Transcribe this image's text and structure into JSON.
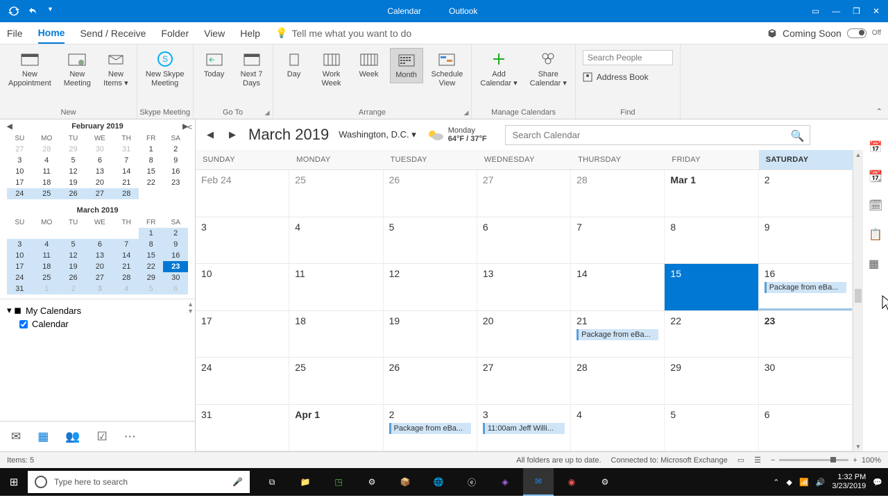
{
  "titlebar": {
    "app_context": "Calendar",
    "app_name": "Outlook"
  },
  "menubar": {
    "tabs": [
      "File",
      "Home",
      "Send / Receive",
      "Folder",
      "View",
      "Help"
    ],
    "tellme": "Tell me what you want to do",
    "coming_soon": "Coming Soon",
    "toggle_state": "Off"
  },
  "ribbon": {
    "groups": {
      "new": {
        "label": "New",
        "buttons": [
          "New\nAppointment",
          "New\nMeeting",
          "New\nItems"
        ]
      },
      "skype": {
        "label": "Skype Meeting",
        "buttons": [
          "New Skype\nMeeting"
        ]
      },
      "goto": {
        "label": "Go To",
        "buttons": [
          "Today",
          "Next 7\nDays"
        ]
      },
      "arrange": {
        "label": "Arrange",
        "buttons": [
          "Day",
          "Work\nWeek",
          "Week",
          "Month",
          "Schedule\nView"
        ]
      },
      "manage": {
        "label": "Manage Calendars",
        "buttons": [
          "Add\nCalendar",
          "Share\nCalendar"
        ]
      },
      "find": {
        "label": "Find",
        "search_placeholder": "Search People",
        "address_book": "Address Book"
      }
    }
  },
  "sidebar": {
    "mini_cals": [
      {
        "title": "February 2019",
        "dow": [
          "SU",
          "MO",
          "TU",
          "WE",
          "TH",
          "FR",
          "SA"
        ],
        "rows": [
          [
            {
              "n": "27",
              "dim": true
            },
            {
              "n": "28",
              "dim": true
            },
            {
              "n": "29",
              "dim": true
            },
            {
              "n": "30",
              "dim": true
            },
            {
              "n": "31",
              "dim": true
            },
            {
              "n": "1"
            },
            {
              "n": "2"
            }
          ],
          [
            {
              "n": "3"
            },
            {
              "n": "4"
            },
            {
              "n": "5"
            },
            {
              "n": "6"
            },
            {
              "n": "7"
            },
            {
              "n": "8"
            },
            {
              "n": "9"
            }
          ],
          [
            {
              "n": "10"
            },
            {
              "n": "11"
            },
            {
              "n": "12"
            },
            {
              "n": "13"
            },
            {
              "n": "14"
            },
            {
              "n": "15"
            },
            {
              "n": "16"
            }
          ],
          [
            {
              "n": "17"
            },
            {
              "n": "18"
            },
            {
              "n": "19"
            },
            {
              "n": "20"
            },
            {
              "n": "21"
            },
            {
              "n": "22"
            },
            {
              "n": "23"
            }
          ],
          [
            {
              "n": "24",
              "hl": true
            },
            {
              "n": "25",
              "hl": true
            },
            {
              "n": "26",
              "hl": true
            },
            {
              "n": "27",
              "hl": true
            },
            {
              "n": "28",
              "hl": true
            },
            {
              "n": ""
            },
            {
              "n": ""
            }
          ]
        ]
      },
      {
        "title": "March 2019",
        "dow": [
          "SU",
          "MO",
          "TU",
          "WE",
          "TH",
          "FR",
          "SA"
        ],
        "rows": [
          [
            {
              "n": ""
            },
            {
              "n": ""
            },
            {
              "n": ""
            },
            {
              "n": ""
            },
            {
              "n": ""
            },
            {
              "n": "1",
              "hl": true
            },
            {
              "n": "2",
              "hl": true
            }
          ],
          [
            {
              "n": "3",
              "hl": true
            },
            {
              "n": "4",
              "hl": true
            },
            {
              "n": "5",
              "hl": true
            },
            {
              "n": "6",
              "hl": true
            },
            {
              "n": "7",
              "hl": true
            },
            {
              "n": "8",
              "hl": true
            },
            {
              "n": "9",
              "hl": true
            }
          ],
          [
            {
              "n": "10",
              "hl": true
            },
            {
              "n": "11",
              "hl": true
            },
            {
              "n": "12",
              "hl": true
            },
            {
              "n": "13",
              "hl": true
            },
            {
              "n": "14",
              "hl": true
            },
            {
              "n": "15",
              "hl": true
            },
            {
              "n": "16",
              "hl": true
            }
          ],
          [
            {
              "n": "17",
              "hl": true
            },
            {
              "n": "18",
              "hl": true
            },
            {
              "n": "19",
              "hl": true
            },
            {
              "n": "20",
              "hl": true
            },
            {
              "n": "21",
              "hl": true
            },
            {
              "n": "22",
              "hl": true
            },
            {
              "n": "23",
              "today": true
            }
          ],
          [
            {
              "n": "24",
              "hl": true
            },
            {
              "n": "25",
              "hl": true
            },
            {
              "n": "26",
              "hl": true
            },
            {
              "n": "27",
              "hl": true
            },
            {
              "n": "28",
              "hl": true
            },
            {
              "n": "29",
              "hl": true
            },
            {
              "n": "30",
              "hl": true
            }
          ],
          [
            {
              "n": "31",
              "hl": true
            },
            {
              "n": "1",
              "hl": true,
              "dim": true
            },
            {
              "n": "2",
              "hl": true,
              "dim": true
            },
            {
              "n": "3",
              "hl": true,
              "dim": true,
              "bold": true
            },
            {
              "n": "4",
              "hl": true,
              "dim": true
            },
            {
              "n": "5",
              "hl": true,
              "dim": true
            },
            {
              "n": "6",
              "hl": true,
              "dim": true
            }
          ]
        ]
      }
    ],
    "my_calendars": {
      "header": "My Calendars",
      "items": [
        {
          "label": "Calendar",
          "checked": true
        }
      ]
    }
  },
  "calendar": {
    "title": "March 2019",
    "location": "Washington, D.C.",
    "weather": {
      "day": "Monday",
      "temps": "64°F / 37°F"
    },
    "search_placeholder": "Search Calendar",
    "dow": [
      "SUNDAY",
      "MONDAY",
      "TUESDAY",
      "WEDNESDAY",
      "THURSDAY",
      "FRIDAY",
      "SATURDAY"
    ],
    "weeks": [
      [
        {
          "n": "Feb 24",
          "dim": true
        },
        {
          "n": "25",
          "dim": true
        },
        {
          "n": "26",
          "dim": true
        },
        {
          "n": "27",
          "dim": true
        },
        {
          "n": "28",
          "dim": true
        },
        {
          "n": "Mar 1",
          "bold": true
        },
        {
          "n": "2"
        }
      ],
      [
        {
          "n": "3"
        },
        {
          "n": "4"
        },
        {
          "n": "5"
        },
        {
          "n": "6"
        },
        {
          "n": "7"
        },
        {
          "n": "8"
        },
        {
          "n": "9"
        }
      ],
      [
        {
          "n": "10"
        },
        {
          "n": "11"
        },
        {
          "n": "12"
        },
        {
          "n": "13"
        },
        {
          "n": "14"
        },
        {
          "n": "15",
          "selected": true
        },
        {
          "n": "16",
          "events": [
            "Package from eBa..."
          ],
          "underline": true
        }
      ],
      [
        {
          "n": "17"
        },
        {
          "n": "18"
        },
        {
          "n": "19"
        },
        {
          "n": "20"
        },
        {
          "n": "21",
          "events": [
            "Package from eBa..."
          ]
        },
        {
          "n": "22"
        },
        {
          "n": "23",
          "bold": true
        }
      ],
      [
        {
          "n": "24"
        },
        {
          "n": "25"
        },
        {
          "n": "26"
        },
        {
          "n": "27"
        },
        {
          "n": "28"
        },
        {
          "n": "29"
        },
        {
          "n": "30"
        }
      ],
      [
        {
          "n": "31"
        },
        {
          "n": "Apr 1",
          "bold": true
        },
        {
          "n": "2",
          "events": [
            "Package from eBa..."
          ]
        },
        {
          "n": "3",
          "events": [
            "11:00am Jeff Willi..."
          ]
        },
        {
          "n": "4"
        },
        {
          "n": "5"
        },
        {
          "n": "6"
        }
      ]
    ]
  },
  "statusbar": {
    "items": "Items: 5",
    "sync": "All folders are up to date.",
    "conn": "Connected to: Microsoft Exchange",
    "zoom": "100%"
  },
  "taskbar": {
    "search_placeholder": "Type here to search",
    "time": "1:32 PM",
    "date": "3/23/2019"
  }
}
